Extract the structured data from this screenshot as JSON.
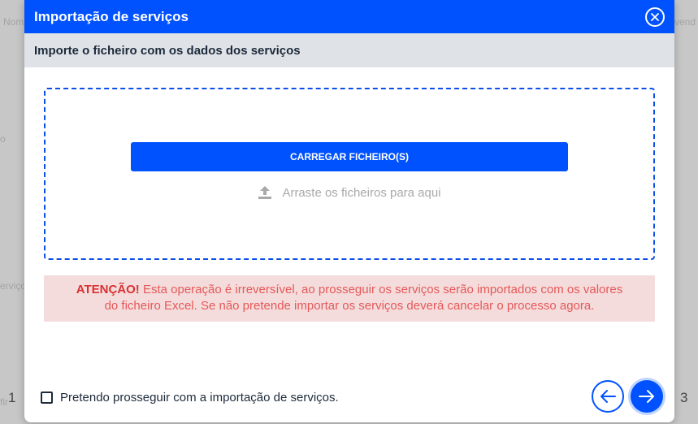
{
  "background": {
    "fragments": [
      "Nom",
      "vend",
      "o",
      "erviço",
      "fir"
    ],
    "step_left": "1",
    "step_right": "3"
  },
  "modal": {
    "title": "Importação de serviços",
    "close_icon": "close-circle-icon",
    "subtitle": "Importe o ficheiro com os dados dos serviços",
    "dropzone": {
      "upload_button_label": "CARREGAR FICHEIRO(S)",
      "drag_hint": "Arraste os ficheiros para aqui",
      "drag_icon": "upload-icon"
    },
    "warning": {
      "label": "ATENÇÃO!",
      "text": " Esta operação é irreversível, ao prosseguir os serviços serão importados com os valores do ficheiro Excel. Se não pretende importar os serviços deverá cancelar o processo agora."
    },
    "confirm_checkbox": {
      "label": "Pretendo prosseguir com a importação de serviços.",
      "checked": false
    },
    "nav": {
      "prev_icon": "arrow-left-icon",
      "next_icon": "arrow-right-icon"
    }
  },
  "colors": {
    "primary": "#0052ff",
    "header_text": "#ffffff",
    "subheader_bg": "#dfe3e8",
    "warning_bg": "#f5dcdc",
    "warning_text": "#e55858"
  }
}
